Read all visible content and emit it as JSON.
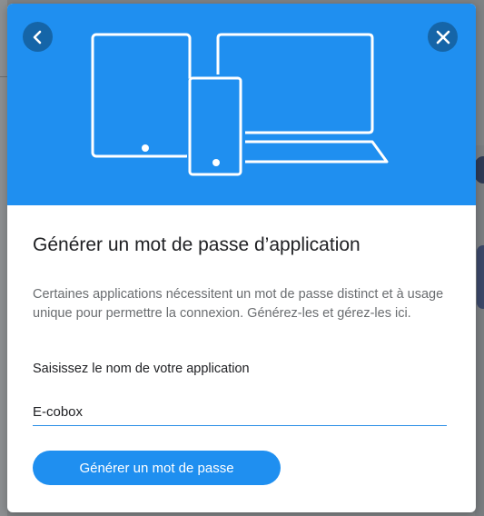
{
  "dialog": {
    "title": "Générer un mot de passe d’application",
    "description": "Certaines applications nécessitent un mot de passe distinct et à usage unique pour permettre la connexion. Générez-les et gérez-les ici.",
    "field_label": "Saisissez le nom de votre application",
    "app_name_value": "E-cobox",
    "generate_button_label": "Générer un mot de passe",
    "icons": {
      "back": "chevron-left-icon",
      "close": "close-icon",
      "illustration": "devices-illustration"
    },
    "colors": {
      "header_bg": "#1f8ff0",
      "nav_button_bg": "#1565a8",
      "button_bg": "#1f8ff0",
      "input_underline": "#2a8ee6"
    }
  }
}
